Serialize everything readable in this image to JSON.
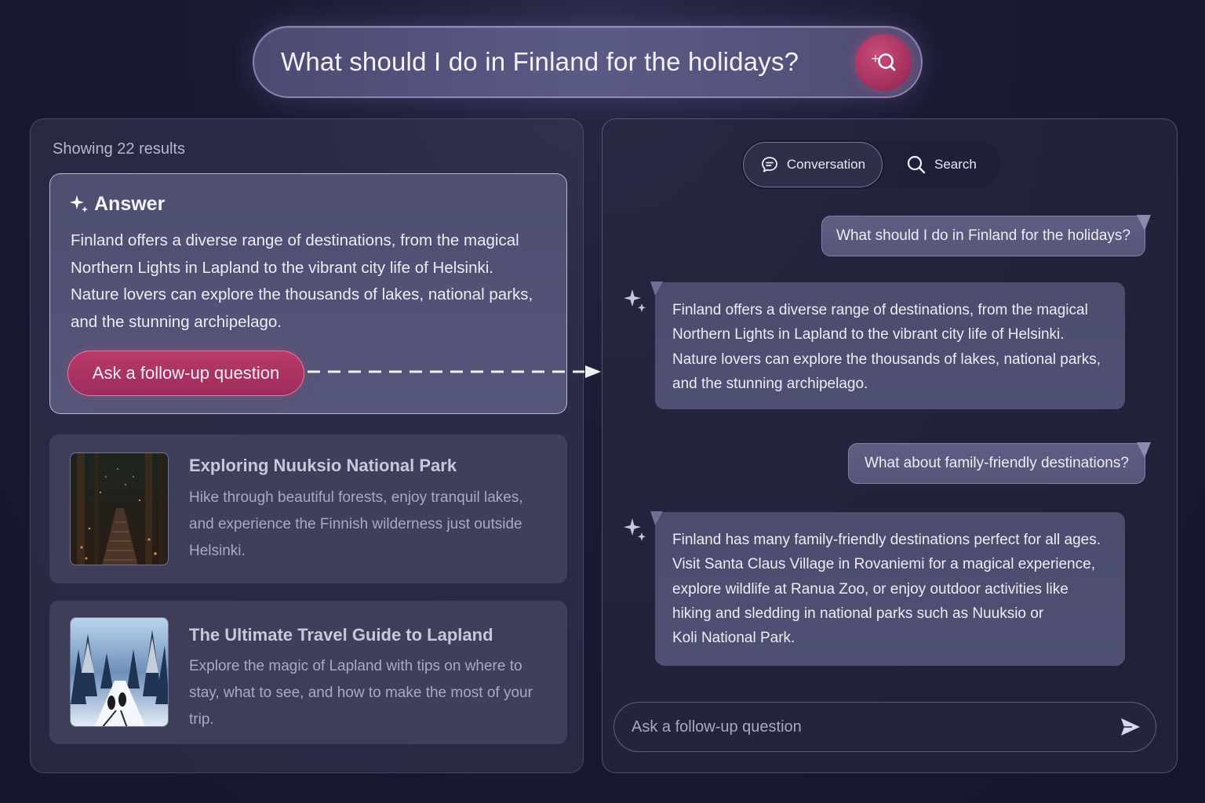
{
  "search": {
    "query": "What should I do in Finland for the holidays?"
  },
  "results": {
    "count_label": "Showing 22 results",
    "answer": {
      "title": "Answer",
      "lines": [
        "Finland offers a diverse range of destinations, from the magical",
        "Northern Lights in Lapland to the vibrant city life of Helsinki.",
        "Nature lovers can explore the thousands of lakes, national parks,",
        "and the stunning archipelago."
      ],
      "followup_label": "Ask a follow-up question"
    },
    "items": [
      {
        "title": "Exploring Nuuksio National Park",
        "lines": [
          "Hike through beautiful forests, enjoy tranquil lakes,",
          "and experience the Finnish wilderness just outside",
          "Helsinki."
        ]
      },
      {
        "title": "The Ultimate Travel Guide to Lapland",
        "lines": [
          "Explore the magic of Lapland with tips on where to",
          "stay, what to see, and how to make the most of your trip."
        ]
      }
    ]
  },
  "chat": {
    "tabs": [
      {
        "label": "Conversation",
        "icon": "chat-bubble-icon",
        "active": true
      },
      {
        "label": "Search",
        "icon": "search-icon",
        "active": false
      }
    ],
    "messages": [
      {
        "role": "user",
        "text": "What should I do in Finland for the holidays?"
      },
      {
        "role": "assistant",
        "lines": [
          "Finland offers a diverse range of destinations, from the magical",
          "Northern Lights in Lapland to the vibrant city life of Helsinki.",
          "Nature lovers can explore the thousands of lakes, national parks,",
          "and the stunning archipelago."
        ]
      },
      {
        "role": "user",
        "text": "What about family-friendly destinations?"
      },
      {
        "role": "assistant",
        "lines": [
          "Finland has many family-friendly destinations perfect for all ages.",
          "Visit Santa Claus Village in Rovaniemi for a magical experience,",
          "explore wildlife at Ranua Zoo, or enjoy outdoor activities like",
          "hiking and sledding in national parks such as Nuuksio or",
          "Koli National Park."
        ]
      }
    ],
    "input_placeholder": "Ask a follow-up question"
  },
  "colors": {
    "accent": "#a02e5c",
    "background": "#1a1b33"
  }
}
